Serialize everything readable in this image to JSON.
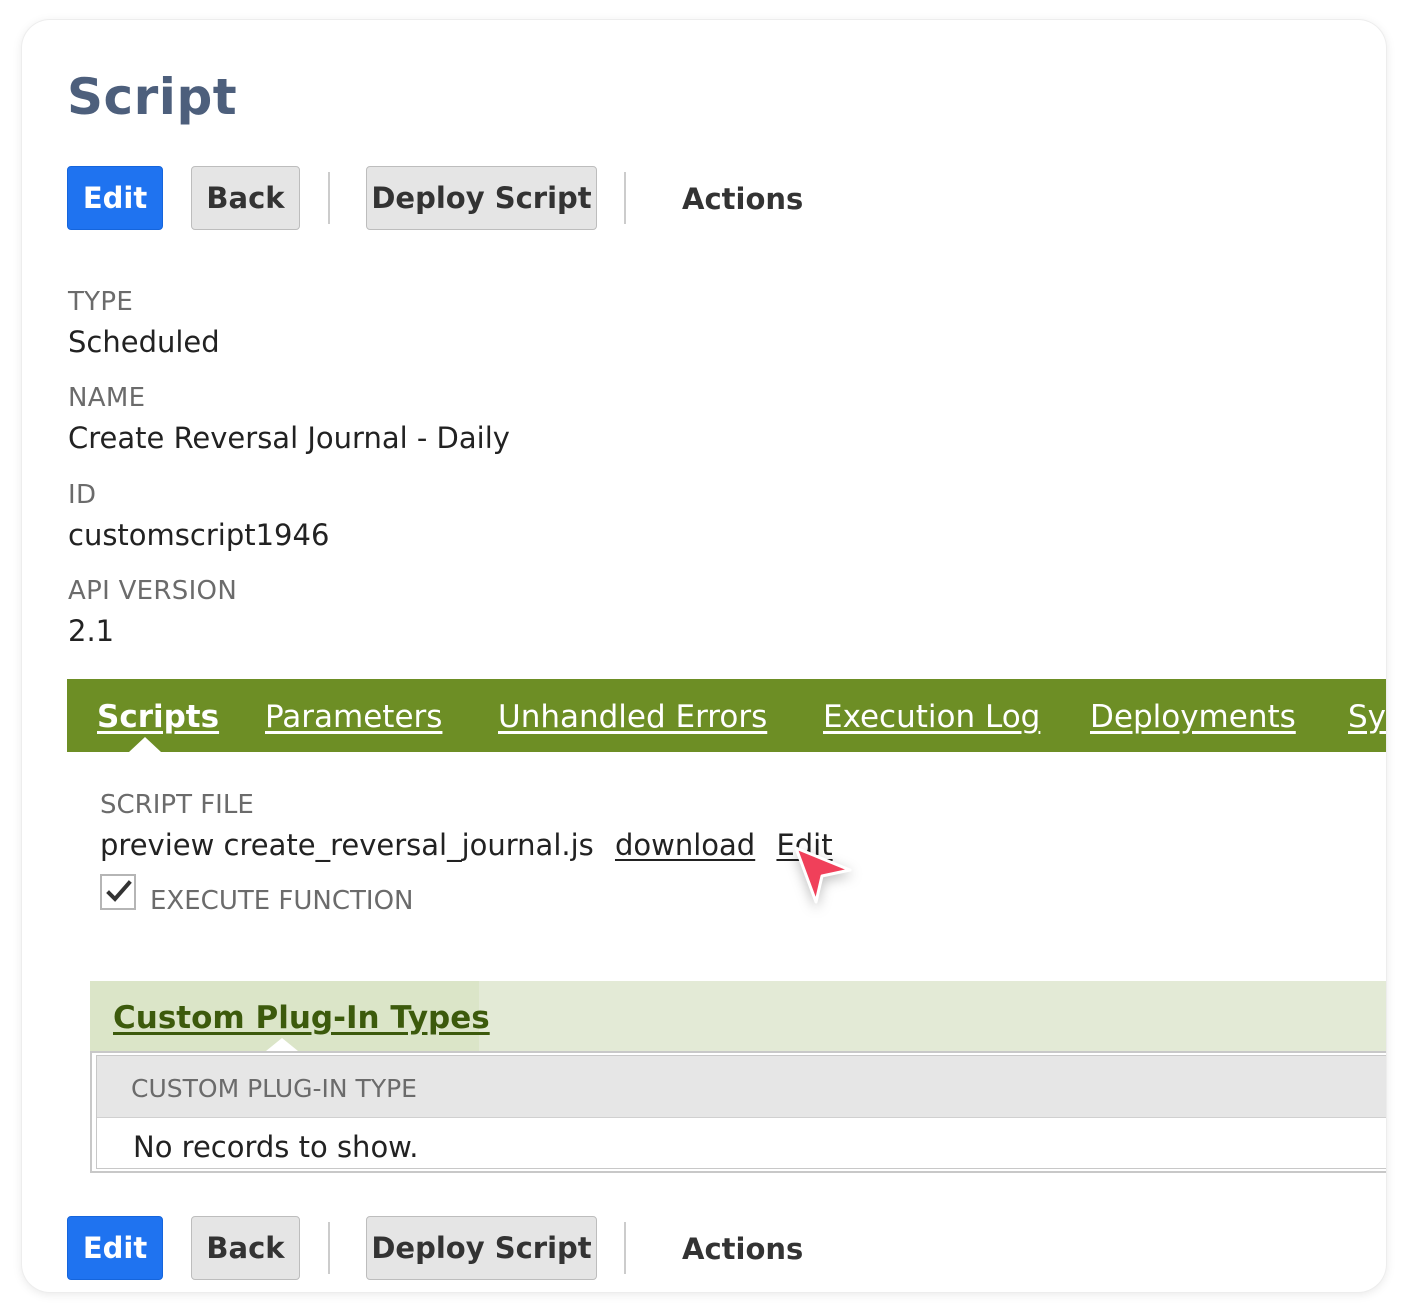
{
  "page": {
    "title": "Script"
  },
  "toolbar": {
    "edit_label": "Edit",
    "back_label": "Back",
    "deploy_label": "Deploy Script",
    "actions_label": "Actions"
  },
  "fields": [
    {
      "label": "TYPE",
      "value": "Scheduled"
    },
    {
      "label": "NAME",
      "value": "Create Reversal Journal - Daily"
    },
    {
      "label": "ID",
      "value": "customscript1946"
    },
    {
      "label": "API VERSION",
      "value": "2.1"
    }
  ],
  "tabs": [
    {
      "label": "Scripts",
      "active": true
    },
    {
      "label": "Parameters"
    },
    {
      "label": "Unhandled Errors"
    },
    {
      "label": "Execution Log"
    },
    {
      "label": "Deployments"
    },
    {
      "label": "System Information"
    }
  ],
  "script_file": {
    "label": "SCRIPT FILE",
    "preview_text": "preview create_reversal_journal.js",
    "download_label": "download",
    "edit_label": "Edit"
  },
  "execute_function": {
    "label": "EXECUTE FUNCTION",
    "checked": true
  },
  "plugin_section": {
    "tab_label": "Custom Plug-In Types",
    "column_header": "CUSTOM PLUG-IN TYPE",
    "empty_text": "No records to show."
  },
  "colors": {
    "title": "#4d5f7c",
    "primary_button": "#1f73f0",
    "tab_bar": "#6d8e25",
    "subtab_text": "#3c5a0c",
    "cursor": "#f0405a"
  }
}
